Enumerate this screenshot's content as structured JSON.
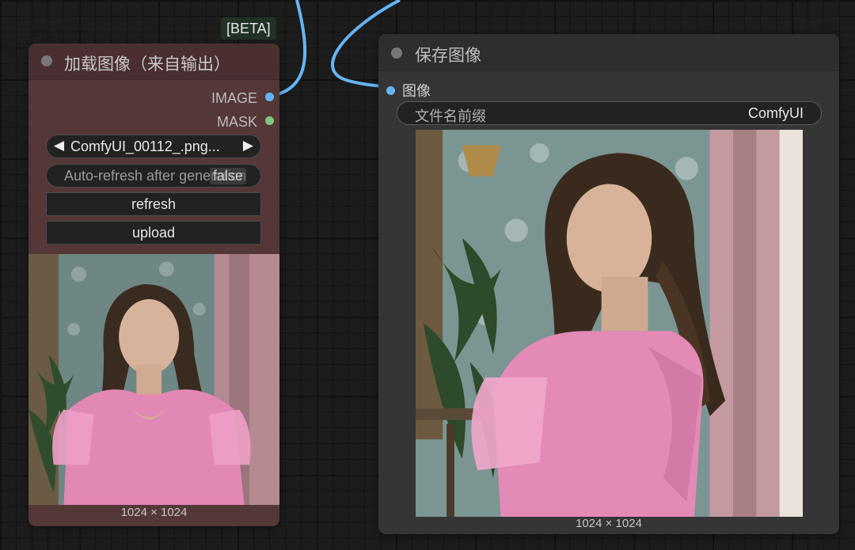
{
  "badge": "[BETA]",
  "load_node": {
    "title": "加载图像（来自输出）",
    "outputs": [
      {
        "label": "IMAGE",
        "color": "#64b5f6"
      },
      {
        "label": "MASK",
        "color": "#81c784"
      }
    ],
    "file_combo": {
      "value": "ComfyUI_00112_.png...",
      "left_arrow": "◀",
      "right_arrow": "▶"
    },
    "auto_refresh": {
      "label": "Auto-refresh after generation",
      "state": "false"
    },
    "refresh_button": "refresh",
    "upload_button": "upload",
    "image_size": "1024 × 1024"
  },
  "save_node": {
    "title": "保存图像",
    "input": {
      "label": "图像",
      "color": "#64b5f6"
    },
    "filename_prefix": {
      "label": "文件名前缀",
      "value": "ComfyUI"
    },
    "image_size": "1024 × 1024"
  },
  "colors": {
    "wire": "#64b5f6",
    "load_node_body": "#553737",
    "load_node_title": "#4a2f31",
    "save_node_body": "#353535"
  }
}
